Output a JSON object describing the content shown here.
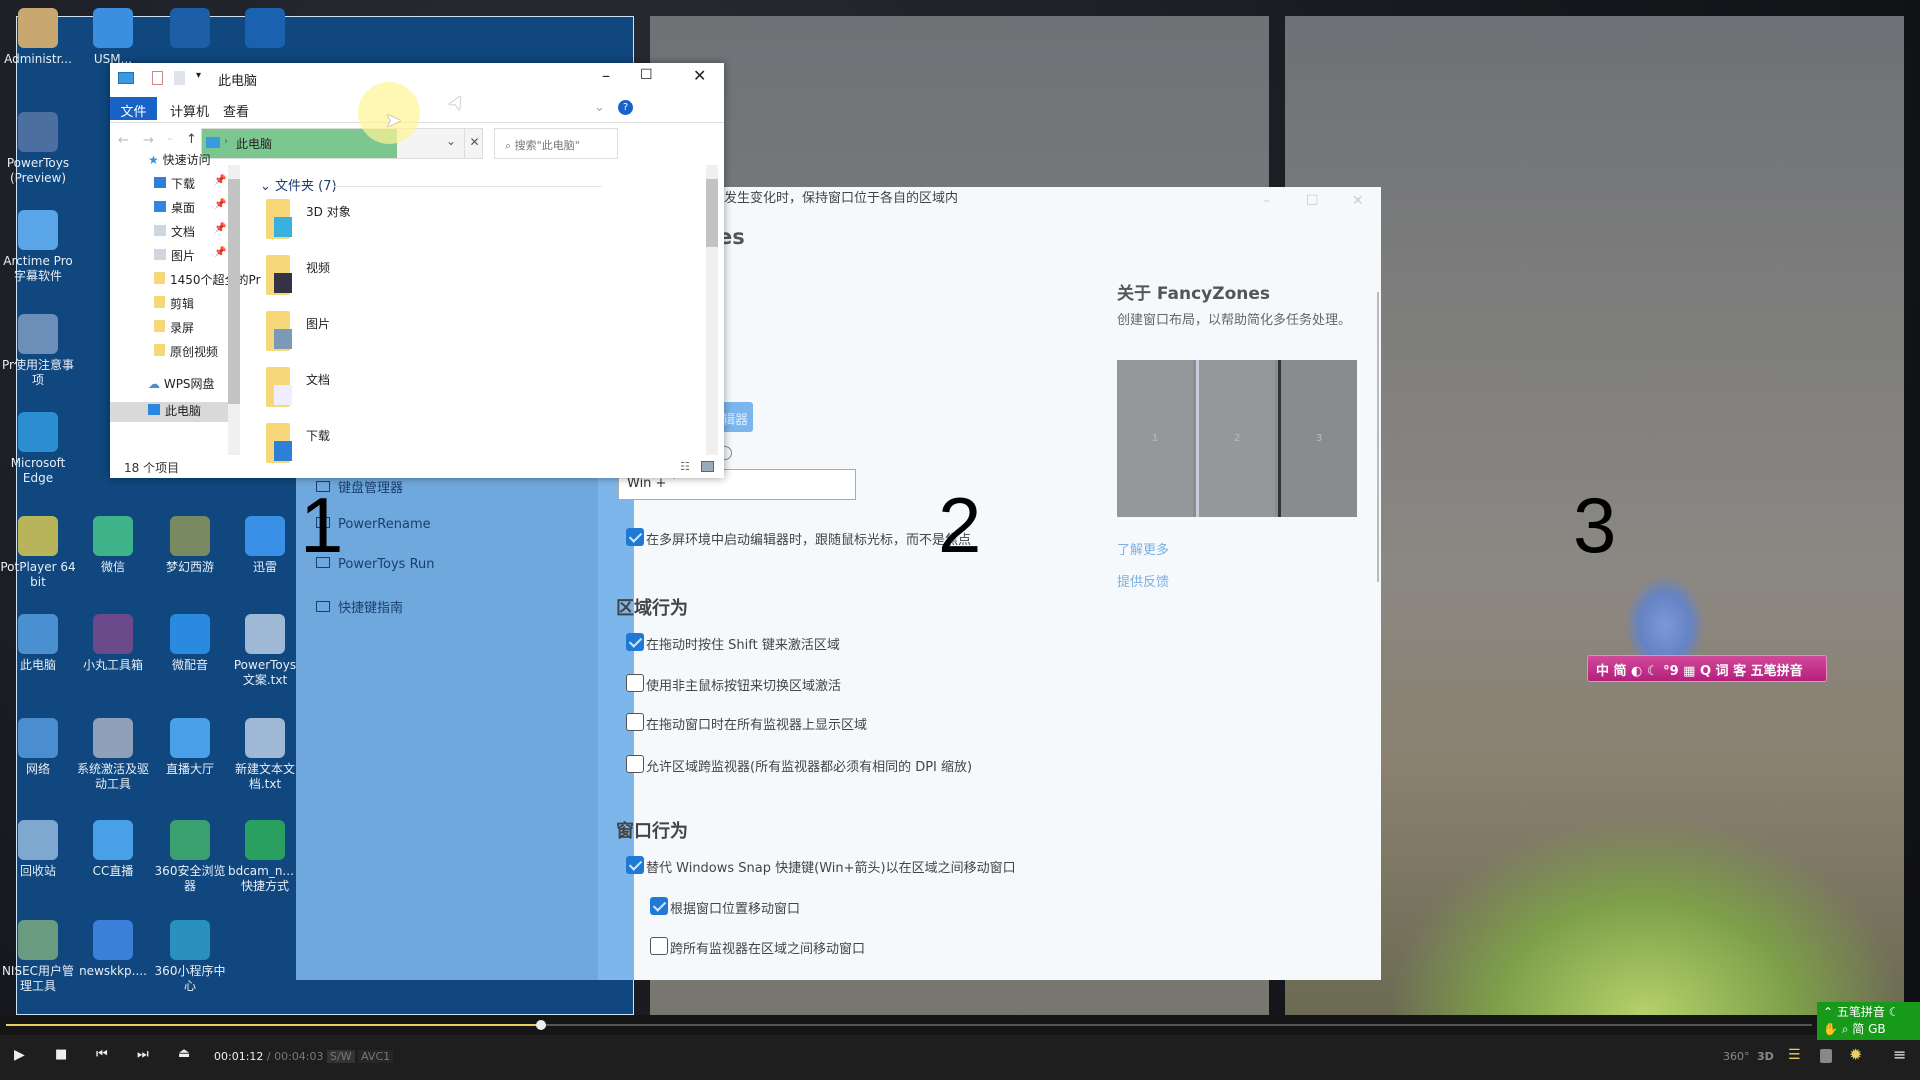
{
  "desktop": {
    "icons": [
      {
        "label": "Administr...",
        "color": "#c8a870"
      },
      {
        "label": "USM...",
        "color": "#3b8fe0"
      },
      {
        "label": "",
        "color": "#1c5ea8"
      },
      {
        "label": "",
        "color": "#1a62b0"
      },
      {
        "label": "PowerToys (Preview)",
        "color": "#4c6fa0"
      },
      {
        "label": "Arctime Pro 字幕软件",
        "color": "#5aa4e8"
      },
      {
        "label": "Pr使用注意事项",
        "color": "#6b8fb8"
      },
      {
        "label": "Microsoft Edge",
        "color": "#2a8ed0"
      },
      {
        "label": "PotPlayer 64 bit",
        "color": "#b7b45a"
      },
      {
        "label": "微信",
        "color": "#3fb38a"
      },
      {
        "label": "梦幻西游",
        "color": "#7a8a60"
      },
      {
        "label": "迅雷",
        "color": "#3a8fe6"
      },
      {
        "label": "此电脑",
        "color": "#4a90d0"
      },
      {
        "label": "小丸工具箱",
        "color": "#6a4a8a"
      },
      {
        "label": "微配音",
        "color": "#2a8ae0"
      },
      {
        "label": "PowerToys 文案.txt",
        "color": "#9fb8d6"
      },
      {
        "label": "网络",
        "color": "#4a8ed0"
      },
      {
        "label": "系统激活及驱动工具",
        "color": "#8fa0b8"
      },
      {
        "label": "直播大厅",
        "color": "#4aa0e8"
      },
      {
        "label": "新建文本文档.txt",
        "color": "#9fb8d6"
      },
      {
        "label": "回收站",
        "color": "#7fa8d0"
      },
      {
        "label": "CC直播",
        "color": "#4aa0e8"
      },
      {
        "label": "360安全浏览器",
        "color": "#3aa070"
      },
      {
        "label": "bdcam_n... - 快捷方式",
        "color": "#2aa060"
      },
      {
        "label": "NISEC用户管理工具",
        "color": "#6a9a80"
      },
      {
        "label": "newskkp....",
        "color": "#3a80d8"
      },
      {
        "label": "360小程序中心",
        "color": "#2a90c0"
      }
    ]
  },
  "zones": [
    "1",
    "2",
    "3"
  ],
  "explorer": {
    "title": "此电脑",
    "tabs": [
      "文件",
      "计算机",
      "查看"
    ],
    "address": "此电脑",
    "search_placeholder": "搜索\"此电脑\"",
    "nav": [
      {
        "label": "快速访问"
      },
      {
        "label": "下载"
      },
      {
        "label": "桌面"
      },
      {
        "label": "文档"
      },
      {
        "label": "图片"
      },
      {
        "label": "1450个超全的Pr"
      },
      {
        "label": "剪辑"
      },
      {
        "label": "录屏"
      },
      {
        "label": "原创视频"
      },
      {
        "label": "WPS网盘"
      },
      {
        "label": "此电脑"
      }
    ],
    "group_header": "文件夹 (7)",
    "folders": [
      "3D 对象",
      "视频",
      "图片",
      "文档",
      "下载"
    ],
    "status": "18 个项目"
  },
  "powertoys": {
    "title_partial": "es",
    "button_partial": "辑器",
    "hotkey_value": "Win + `",
    "nav": [
      "键盘管理器",
      "PowerRename",
      "PowerToys Run",
      "快捷键指南"
    ],
    "options": [
      {
        "label": "在多屏环境中启动编辑器时，跟随鼠标光标，而不是焦点",
        "checked": true
      },
      {
        "heading": "区域行为"
      },
      {
        "label": "在拖动时按住 Shift 键来激活区域",
        "checked": true
      },
      {
        "label": "使用非主鼠标按钮来切换区域激活",
        "checked": false
      },
      {
        "label": "在拖动窗口时在所有监视器上显示区域",
        "checked": false
      },
      {
        "label": "允许区域跨监视器(所有监视器都必须有相同的 DPI 缩放)",
        "checked": false
      },
      {
        "heading": "窗口行为"
      },
      {
        "label": "替代 Windows Snap 快捷键(Win+箭头)以在区域之间移动窗口",
        "checked": true
      },
      {
        "label": "根据窗口位置移动窗口",
        "checked": true,
        "indent": true
      },
      {
        "label": "跨所有监视器在区域之间移动窗口",
        "checked": false,
        "indent": true
      },
      {
        "label": "当屏幕分辨率发生变化时，保持窗口位于各自的区域内",
        "checked": true
      }
    ],
    "about_title": "关于 FancyZones",
    "about_desc": "创建窗口布局，以帮助简化多任务处理。",
    "preview_zones": [
      "1",
      "2",
      "3"
    ],
    "links": [
      "了解更多",
      "提供反馈"
    ]
  },
  "ime": {
    "bar": "中 简 ◐ ☾ °9 ▦ Q 词 客 五笔拼音",
    "tray_top": "五笔拼音",
    "tray_bottom": "简 GB"
  },
  "player": {
    "elapsed": "00:01:12",
    "total": "00:04:03",
    "progress": 0.296,
    "badge1": "S/W",
    "badge2": "AVC1",
    "right_icons": [
      "360°",
      "3D"
    ],
    "accent": "#e8d060"
  }
}
